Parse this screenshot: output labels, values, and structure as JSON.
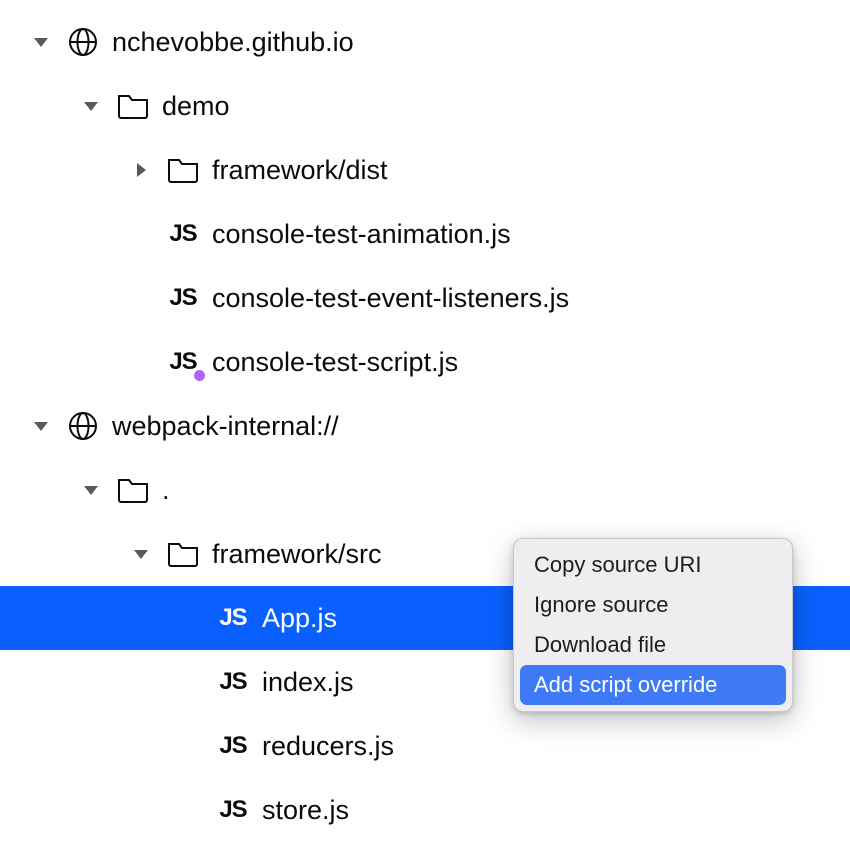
{
  "tree": {
    "rows": [
      {
        "depth": 0,
        "expand": "down",
        "icon": "globe",
        "label": "nchevobbe.github.io",
        "selected": false,
        "dot": false
      },
      {
        "depth": 1,
        "expand": "down",
        "icon": "folder",
        "label": "demo",
        "selected": false,
        "dot": false
      },
      {
        "depth": 2,
        "expand": "right",
        "icon": "folder",
        "label": "framework/dist",
        "selected": false,
        "dot": false
      },
      {
        "depth": 2,
        "expand": "none",
        "icon": "js",
        "label": "console-test-animation.js",
        "selected": false,
        "dot": false
      },
      {
        "depth": 2,
        "expand": "none",
        "icon": "js",
        "label": "console-test-event-listeners.js",
        "selected": false,
        "dot": false
      },
      {
        "depth": 2,
        "expand": "none",
        "icon": "js",
        "label": "console-test-script.js",
        "selected": false,
        "dot": true
      },
      {
        "depth": 0,
        "expand": "down",
        "icon": "globe",
        "label": "webpack-internal://",
        "selected": false,
        "dot": false
      },
      {
        "depth": 1,
        "expand": "down",
        "icon": "folder",
        "label": ".",
        "selected": false,
        "dot": false
      },
      {
        "depth": 2,
        "expand": "down",
        "icon": "folder",
        "label": "framework/src",
        "selected": false,
        "dot": false
      },
      {
        "depth": 3,
        "expand": "none",
        "icon": "js",
        "label": "App.js",
        "selected": true,
        "dot": false
      },
      {
        "depth": 3,
        "expand": "none",
        "icon": "js",
        "label": "index.js",
        "selected": false,
        "dot": false
      },
      {
        "depth": 3,
        "expand": "none",
        "icon": "js",
        "label": "reducers.js",
        "selected": false,
        "dot": false
      },
      {
        "depth": 3,
        "expand": "none",
        "icon": "js",
        "label": "store.js",
        "selected": false,
        "dot": false
      }
    ]
  },
  "context_menu": {
    "items": [
      {
        "label": "Copy source URI",
        "highlighted": false
      },
      {
        "label": "Ignore source",
        "highlighted": false
      },
      {
        "label": "Download file",
        "highlighted": false
      },
      {
        "label": "Add script override",
        "highlighted": true
      }
    ]
  },
  "icons": {
    "js_text": "JS"
  }
}
